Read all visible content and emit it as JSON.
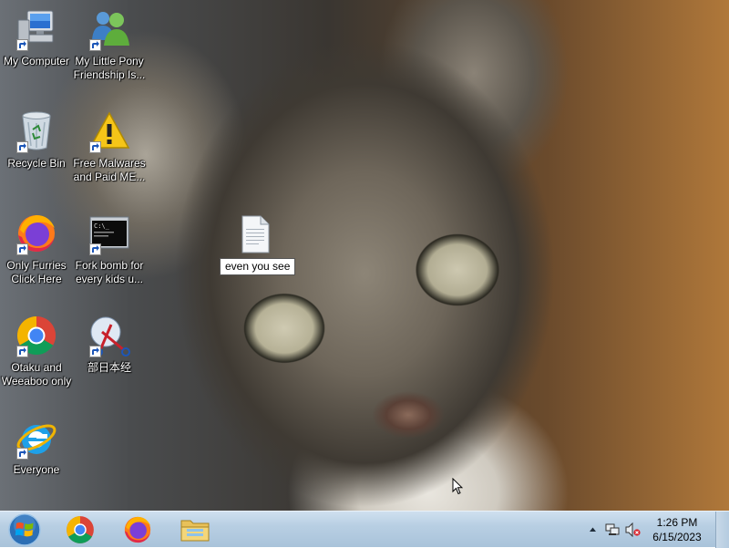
{
  "desktop": {
    "icons": [
      {
        "label": "My Computer",
        "icon": "computer-icon",
        "shortcut": true
      },
      {
        "label": "My Little Pony Friendship Is...",
        "icon": "users-icon",
        "shortcut": true
      },
      {
        "label": "Recycle Bin",
        "icon": "recycle-bin-icon",
        "shortcut": true
      },
      {
        "label": "Free Malwares and Paid ME...",
        "icon": "warning-icon",
        "shortcut": true
      },
      {
        "label": "Only Furries Click Here",
        "icon": "firefox-icon",
        "shortcut": true
      },
      {
        "label": "Fork bomb for every kids u...",
        "icon": "command-prompt-icon",
        "shortcut": true
      },
      {
        "label": "Otaku and Weeaboo only",
        "icon": "chrome-icon",
        "shortcut": true
      },
      {
        "label": "部日本经",
        "icon": "snipping-tool-icon",
        "shortcut": true
      },
      {
        "label": "Everyone",
        "icon": "internet-explorer-icon",
        "shortcut": true
      }
    ],
    "file": {
      "label": "even you see",
      "icon": "text-file-icon"
    }
  },
  "taskbar": {
    "pinned": [
      "chrome-icon",
      "firefox-icon",
      "file-explorer-icon"
    ],
    "tray": {
      "icons": [
        "show-hidden-icons-icon",
        "network-icon",
        "volume-muted-icon"
      ],
      "time": "1:26 PM",
      "date": "6/15/2023"
    }
  }
}
